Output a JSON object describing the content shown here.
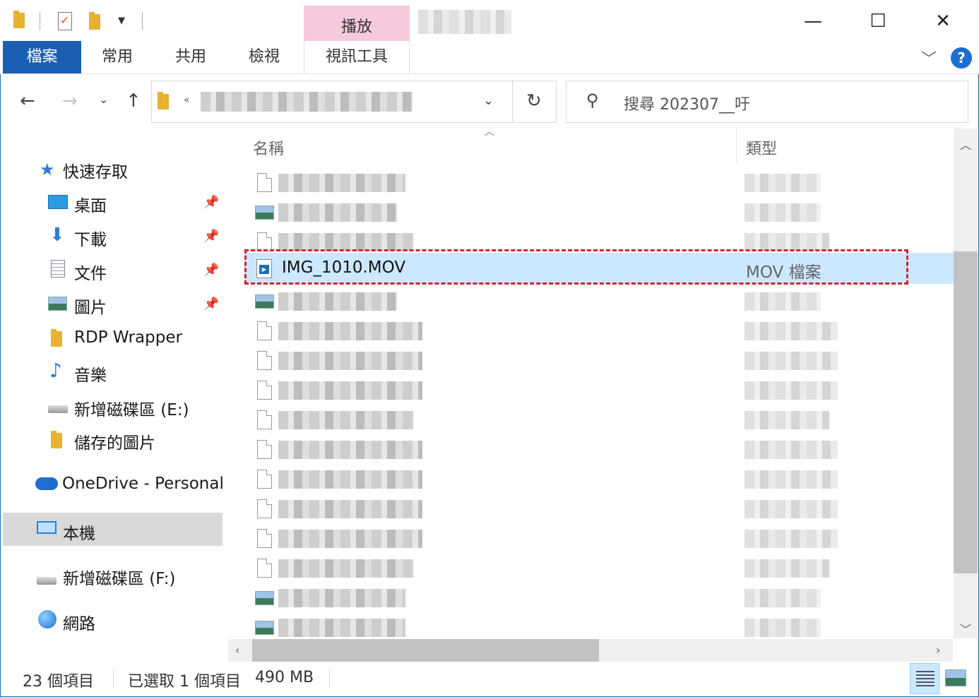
{
  "ribbon": {
    "context_group": "播放",
    "tabs": [
      "檔案",
      "常用",
      "共用",
      "檢視",
      "視訊工具"
    ]
  },
  "search": {
    "placeholder": "搜尋 202307__吁"
  },
  "nav": {
    "quick_access": "快速存取",
    "pinned": [
      {
        "label": "桌面",
        "icon": "desktop-icon",
        "pinned": true
      },
      {
        "label": "下載",
        "icon": "download-icon",
        "pinned": true
      },
      {
        "label": "文件",
        "icon": "documents-icon",
        "pinned": true
      },
      {
        "label": "圖片",
        "icon": "pictures-icon",
        "pinned": true
      }
    ],
    "others": [
      {
        "label": "RDP Wrapper",
        "icon": "folder-icon"
      },
      {
        "label": "音樂",
        "icon": "music-icon"
      },
      {
        "label": "新增磁碟區 (E:)",
        "icon": "drive-icon"
      },
      {
        "label": "儲存的圖片",
        "icon": "folder-icon"
      }
    ],
    "onedrive": "OneDrive - Personal",
    "this_pc": "本機",
    "drive_f": "新增磁碟區 (F:)",
    "network": "網路"
  },
  "columns": {
    "name": "名稱",
    "type": "類型"
  },
  "selected_file": {
    "name": "IMG_1010.MOV",
    "type": "MOV 檔案"
  },
  "status": {
    "item_count": "23 個項目",
    "selected_count": "已選取 1 個項目",
    "selected_size": "490 MB"
  },
  "colors": {
    "accent": "#1a5fb4",
    "selection": "#cce8ff",
    "highlight_border": "#d9202b",
    "context_tab": "#f7c9dd"
  }
}
